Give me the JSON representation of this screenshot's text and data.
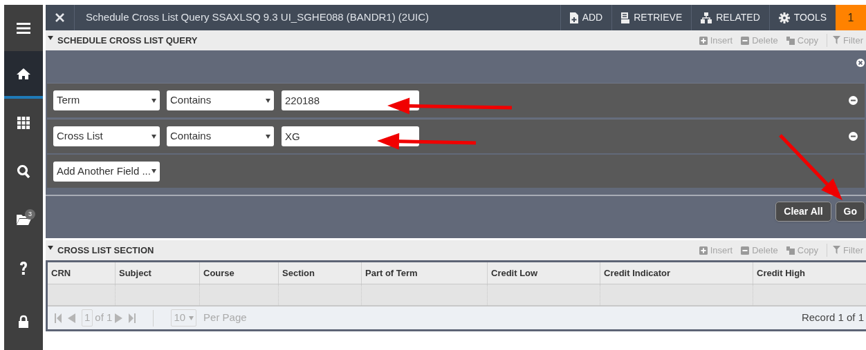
{
  "sidebar": {
    "items": [
      {
        "kind": "menu",
        "selected": false
      },
      {
        "kind": "home",
        "selected": true
      },
      {
        "kind": "apps",
        "selected": false
      },
      {
        "kind": "search",
        "selected": false
      },
      {
        "kind": "folder",
        "selected": false,
        "badge": "3"
      },
      {
        "kind": "help",
        "selected": false
      },
      {
        "kind": "lock",
        "selected": false
      }
    ]
  },
  "header": {
    "title": "Schedule Cross List Query SSAXLSQ 9.3 UI_SGHE088 (BANDR1) (2UIC)",
    "actions": [
      {
        "kind": "add",
        "label": "ADD"
      },
      {
        "kind": "retrieve",
        "label": "RETRIEVE"
      },
      {
        "kind": "related",
        "label": "RELATED"
      },
      {
        "kind": "tools",
        "label": "TOOLS"
      }
    ],
    "notifications": "1"
  },
  "query_section": {
    "title": "SCHEDULE CROSS LIST QUERY",
    "tools": [
      {
        "kind": "insert",
        "label": "Insert",
        "disabled": true
      },
      {
        "kind": "delete",
        "label": "Delete",
        "disabled": true
      },
      {
        "kind": "copy",
        "label": "Copy",
        "disabled": true
      },
      {
        "kind": "filter",
        "label": "Filter",
        "disabled": true
      }
    ],
    "criteria": [
      {
        "field": "Term",
        "operator": "Contains",
        "value": "220188"
      },
      {
        "field": "Cross List",
        "operator": "Contains",
        "value": "XG"
      }
    ],
    "add_field": "Add Another Field ...",
    "buttons": [
      "Clear All",
      "Go"
    ]
  },
  "cross_list_section": {
    "title": "CROSS LIST SECTION",
    "tools": [
      {
        "kind": "insert",
        "label": "Insert",
        "disabled": true
      },
      {
        "kind": "delete",
        "label": "Delete",
        "disabled": true
      },
      {
        "kind": "copy",
        "label": "Copy",
        "disabled": true
      },
      {
        "kind": "filter",
        "label": "Filter",
        "disabled": true
      }
    ],
    "table": {
      "columns": [
        "CRN",
        "Subject",
        "Course",
        "Section",
        "Part of Term",
        "Credit Low",
        "Credit Indicator",
        "Credit High"
      ]
    },
    "pager": {
      "page": "1",
      "page_count": "of 1",
      "per_page": "10",
      "per_page_label": "Per Page",
      "record": "Record 1 of 1"
    }
  }
}
